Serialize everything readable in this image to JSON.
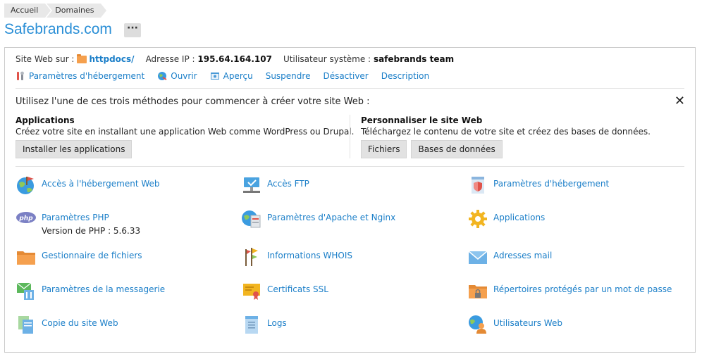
{
  "breadcrumb": [
    "Accueil",
    "Domaines"
  ],
  "title": "Safebrands.com",
  "more_label": "···",
  "info": {
    "site_label": "Site Web sur :",
    "site_folder": "httpdocs/",
    "ip_label": "Adresse IP :",
    "ip_value": "195.64.164.107",
    "user_label": "Utilisateur système :",
    "user_value": "safebrands team"
  },
  "actions": [
    {
      "label": "Paramètres d'hébergement",
      "icon": "tools-icon"
    },
    {
      "label": "Ouvrir",
      "icon": "globe-open-icon"
    },
    {
      "label": "Aperçu",
      "icon": "preview-icon"
    },
    {
      "label": "Suspendre",
      "icon": ""
    },
    {
      "label": "Désactiver",
      "icon": ""
    },
    {
      "label": "Description",
      "icon": ""
    }
  ],
  "start": {
    "text": "Utilisez l'une de ces trois méthodes pour commencer à créer votre site Web :",
    "close": "✕",
    "apps": {
      "title": "Applications",
      "desc": "Créez votre site en installant une application Web comme WordPress ou Drupal.",
      "button": "Installer les applications"
    },
    "custom": {
      "title": "Personnaliser le site Web",
      "desc": "Téléchargez le contenu de votre site et créez des bases de données.",
      "button_files": "Fichiers",
      "button_db": "Bases de données"
    }
  },
  "tools": [
    {
      "label": "Accès à l'hébergement Web",
      "icon": "web-hosting-icon"
    },
    {
      "label": "Accès FTP",
      "icon": "ftp-icon"
    },
    {
      "label": "Paramètres d'hébergement",
      "icon": "hosting-settings-icon"
    },
    {
      "label": "Paramètres PHP",
      "sub": "Version de PHP : 5.6.33",
      "icon": "php-icon"
    },
    {
      "label": "Paramètres d'Apache et Nginx",
      "icon": "apache-nginx-icon"
    },
    {
      "label": "Applications",
      "icon": "applications-gear-icon"
    },
    {
      "label": "Gestionnaire de fichiers",
      "icon": "file-manager-icon"
    },
    {
      "label": "Informations WHOIS",
      "icon": "whois-icon"
    },
    {
      "label": "Adresses mail",
      "icon": "mail-icon"
    },
    {
      "label": "Paramètres de la messagerie",
      "icon": "mail-settings-icon"
    },
    {
      "label": "Certificats SSL",
      "icon": "ssl-certificate-icon"
    },
    {
      "label": "Répertoires protégés par un mot de passe",
      "icon": "protected-folder-icon"
    },
    {
      "label": "Copie du site Web",
      "icon": "site-copy-icon"
    },
    {
      "label": "Logs",
      "icon": "logs-icon"
    },
    {
      "label": "Utilisateurs Web",
      "icon": "web-users-icon"
    }
  ],
  "colors": {
    "link": "#1a7ec8",
    "title": "#2b8fd6",
    "folder": "#f5a04e"
  }
}
